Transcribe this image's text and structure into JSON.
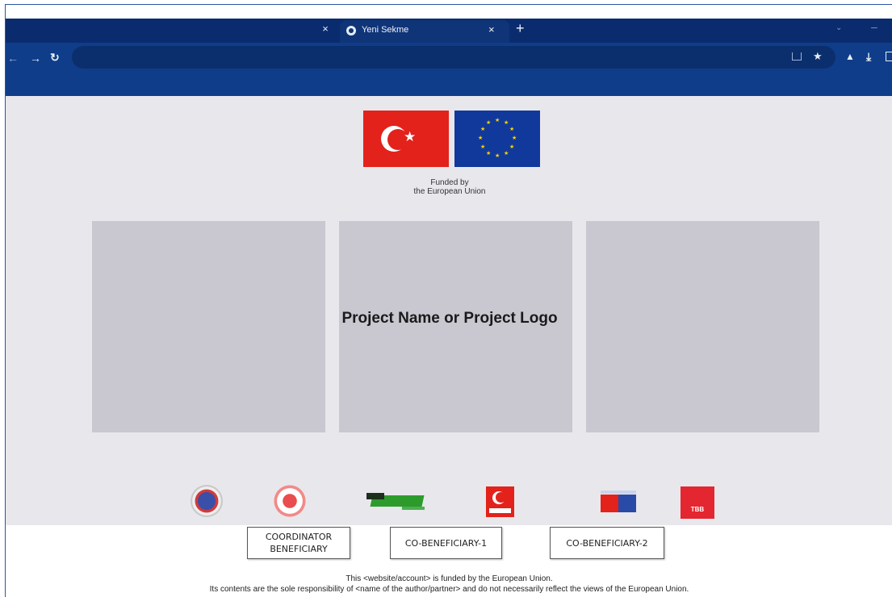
{
  "browser": {
    "active_tab_title": "Yeni Sekme",
    "tab_close_glyph": "×",
    "new_tab_glyph": "+",
    "icons": [
      "back-arrow-icon",
      "forward-arrow-icon",
      "reload-icon",
      "share-icon",
      "star-icon",
      "extensions-icon",
      "download-icon",
      "side-panel-icon"
    ]
  },
  "header": {
    "funded_line1": "Funded by",
    "funded_line2": "the European Union"
  },
  "main": {
    "project_title": "Project Name or Project Logo"
  },
  "partners": {
    "logos": [
      "partner-logo-1",
      "partner-logo-2",
      "partner-logo-3",
      "partner-logo-4",
      "partner-logo-5",
      "partner-logo-6"
    ],
    "logo6_text": "TBB"
  },
  "beneficiaries": {
    "coordinator_line1": "COORDINATOR",
    "coordinator_line2": "BENEFICIARY",
    "co1": "CO-BENEFICIARY-1",
    "co2": "CO-BENEFICIARY-2"
  },
  "footer": {
    "disclaimer_line1": "This <website/account> is funded by the European Union.",
    "disclaimer_line2": "Its contents are the sole responsibility of <name of the author/partner> and do not necessarily reflect the views of the European Union."
  },
  "colors": {
    "tabstrip": "#0a2c6e",
    "toolbar": "#0f3d8a",
    "page_bg": "#e8e7ec",
    "panel": "#c9c7d0",
    "turkey_red": "#e2221b",
    "eu_blue": "#11399b",
    "eu_gold": "#ffd200"
  }
}
